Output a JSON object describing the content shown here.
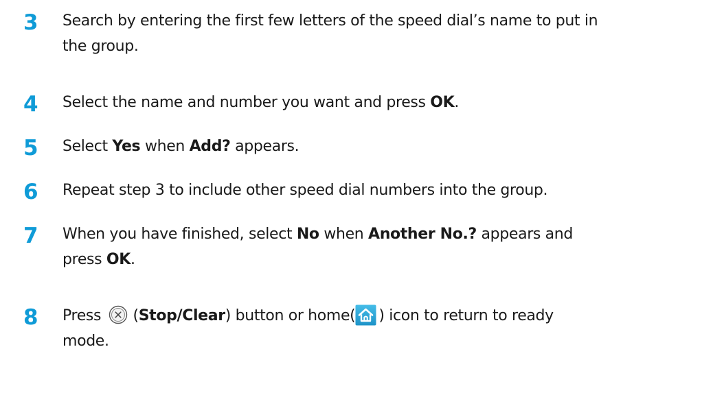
{
  "steps": [
    {
      "number": "3",
      "lines": [
        "Search by entering the first few letters of the speed dial’s name to put in",
        "the group."
      ]
    },
    {
      "number": "4",
      "t1": "Select the name and number you want and press ",
      "b1": "OK",
      "t2": "."
    },
    {
      "number": "5",
      "t1": "Select ",
      "b1": "Yes",
      "t2": " when ",
      "b2": "Add?",
      "t3": " appears."
    },
    {
      "number": "6",
      "t1": "Repeat step 3 to include other speed dial numbers into the group."
    },
    {
      "number": "7",
      "t1": "When you have finished, select ",
      "b1": "No",
      "t2": " when ",
      "b2": "Another No.?",
      "t3": " appears and",
      "t4": "press ",
      "b3": "OK",
      "t5": "."
    },
    {
      "number": "8",
      "t1": "Press ",
      "t2": " (",
      "b1": "Stop/Clear",
      "t3": ") button or home(",
      "t4": ") icon to return to ready",
      "t5": "mode."
    }
  ],
  "icons": {
    "stop_clear": "stop-clear-button-icon",
    "home": "home-icon"
  },
  "colors": {
    "step_number": "#0f9bd7",
    "body_text": "#1a1a1a",
    "home_icon_bg": "#2aa9d8"
  }
}
